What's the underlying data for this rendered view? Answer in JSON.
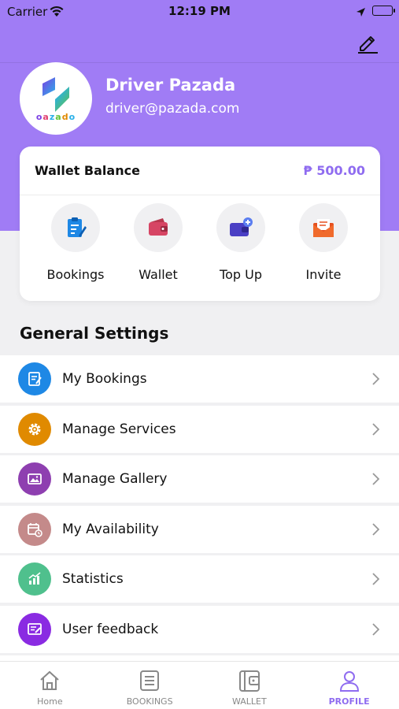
{
  "status_bar": {
    "carrier": "Carrier",
    "time": "12:19 PM"
  },
  "profile": {
    "name": "Driver Pazada",
    "email": "driver@pazada.com",
    "logo_text": "oazado"
  },
  "wallet": {
    "label": "Wallet Balance",
    "amount": "₱ 500.00"
  },
  "quick_actions": [
    {
      "label": "Bookings",
      "icon": "clipboard-icon"
    },
    {
      "label": "Wallet",
      "icon": "wallet-icon"
    },
    {
      "label": "Top Up",
      "icon": "top-up-icon"
    },
    {
      "label": "Invite",
      "icon": "envelope-icon"
    }
  ],
  "general_settings": {
    "title": "General Settings",
    "items": [
      {
        "label": "My Bookings",
        "icon": "clipboard-icon",
        "color": "#1e88e5"
      },
      {
        "label": "Manage Services",
        "icon": "gear-icon",
        "color": "#e08a00"
      },
      {
        "label": "Manage Gallery",
        "icon": "gallery-icon",
        "color": "#8e3fb0"
      },
      {
        "label": "My Availability",
        "icon": "calendar-clock-icon",
        "color": "#c48a8a"
      },
      {
        "label": "Statistics",
        "icon": "chart-icon",
        "color": "#4fc08d"
      },
      {
        "label": "User feedback",
        "icon": "feedback-icon",
        "color": "#8a2be2"
      }
    ]
  },
  "tabbar": [
    {
      "label": "Home",
      "icon": "home-icon",
      "active": false
    },
    {
      "label": "BOOKINGS",
      "icon": "list-icon",
      "active": false
    },
    {
      "label": "WALLET",
      "icon": "wallet-icon",
      "active": false
    },
    {
      "label": "PROFILE",
      "icon": "user-icon",
      "active": true
    }
  ],
  "colors": {
    "accent": "#a07cf5",
    "accent_text": "#8f6cf0"
  }
}
